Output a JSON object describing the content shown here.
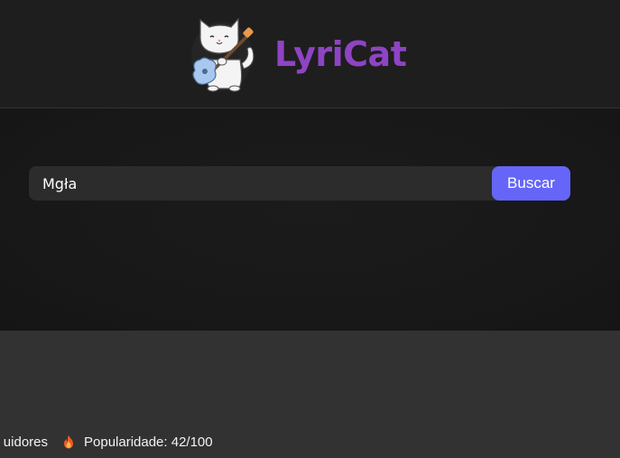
{
  "header": {
    "logo_text": "LyriCat",
    "mascot_icon": "cat-playing-guitar-icon",
    "colors": {
      "brand": "#8e44c4"
    }
  },
  "search": {
    "value": "Mgła",
    "button_label": "Buscar",
    "colors": {
      "button": "#6566f8"
    }
  },
  "artist_stats": {
    "followers_text": "uidores",
    "popularity_icon": "fire-icon",
    "popularity_text": "Popularidade: 42/100"
  }
}
